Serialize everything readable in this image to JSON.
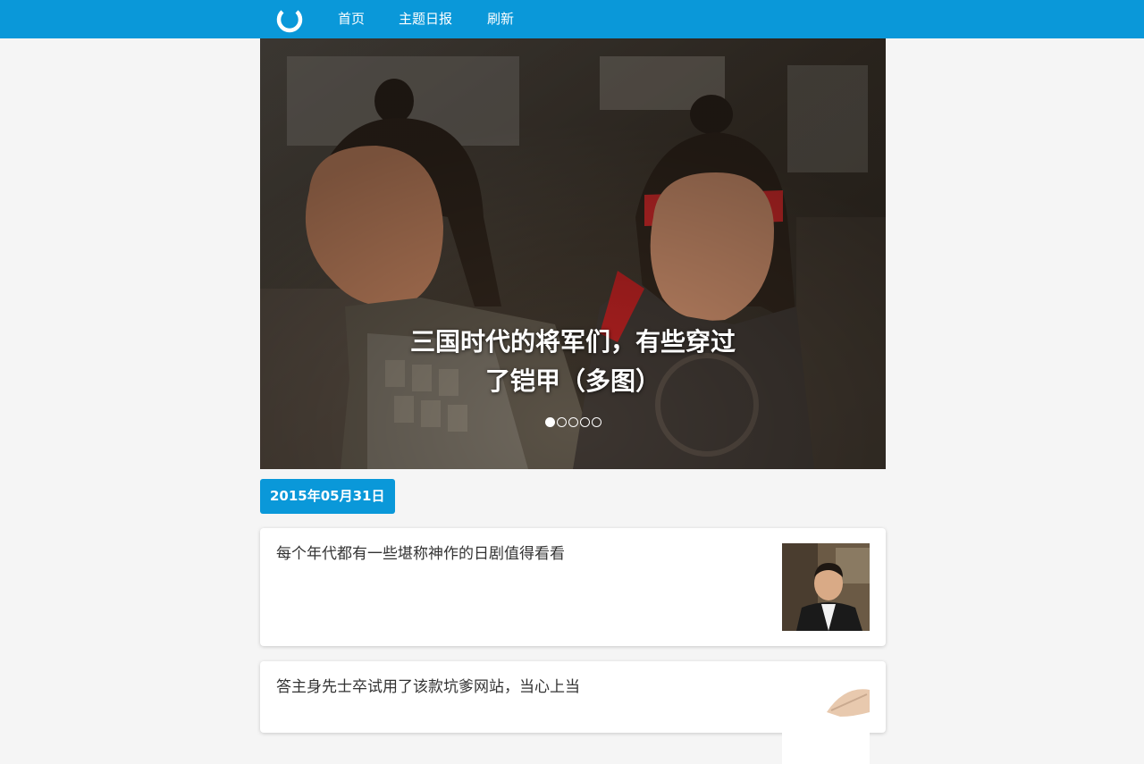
{
  "topbar": {
    "logo_icon": "loading-ring-icon",
    "nav": [
      {
        "label": "首页"
      },
      {
        "label": "主题日报"
      },
      {
        "label": "刷新"
      }
    ],
    "color": "#0a98d9"
  },
  "hero": {
    "title_line1": "三国时代的将军们，有些穿过",
    "title_line2": "了铠甲（多图）",
    "slide_count": 5,
    "active_slide": 1
  },
  "date_badge": "2015年05月31日",
  "stories": [
    {
      "title": "每个年代都有一些堪称神作的日剧值得看看"
    },
    {
      "title": "答主身先士卒试用了该款坑爹网站，当心上当"
    }
  ]
}
